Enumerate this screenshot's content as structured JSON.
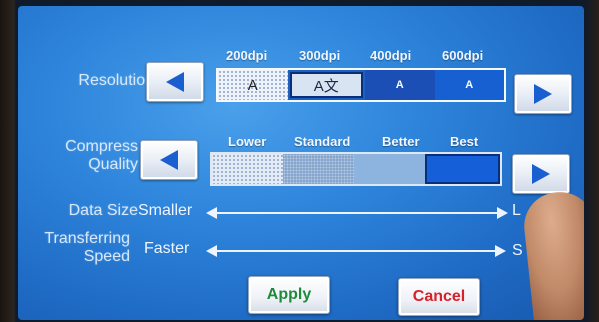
{
  "resolution": {
    "label": "Resolution",
    "options": [
      "200dpi",
      "300dpi",
      "400dpi",
      "600dpi"
    ],
    "segment_glyphs": [
      "A",
      "A文",
      "A",
      "A"
    ],
    "selected": "300dpi"
  },
  "compress_quality": {
    "label_line1": "Compress",
    "label_line2": "Quality",
    "options": [
      "Lower",
      "Standard",
      "Better",
      "Best"
    ],
    "selected": "Best"
  },
  "data_size": {
    "label": "Data Size",
    "left_text": "Smaller",
    "right_text": "L"
  },
  "transferring_speed": {
    "label_line1": "Transferring",
    "label_line2": "Speed",
    "left_text": "Faster",
    "right_text": "S"
  },
  "actions": {
    "apply_label": "Apply",
    "cancel_label": "Cancel"
  },
  "colors": {
    "screen_blue": "#2f86dc",
    "apply_text": "#1f8a3a",
    "cancel_text": "#d8202a",
    "arrow_blue": "#1a5fd0"
  },
  "icons": {
    "left_arrow": "triangle-left-icon",
    "right_arrow": "triangle-right-icon"
  }
}
